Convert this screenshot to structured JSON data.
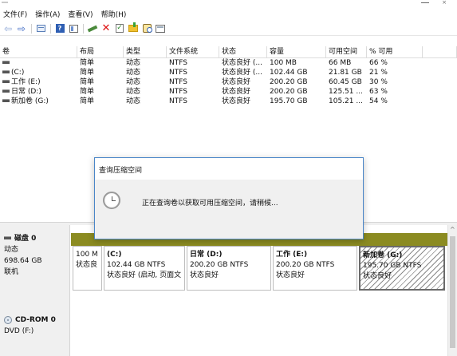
{
  "menu": [
    "文件(F)",
    "操作(A)",
    "查看(V)",
    "帮助(H)"
  ],
  "toolbar": [
    {
      "icon": "back-arrow-icon"
    },
    {
      "icon": "forward-arrow-icon"
    },
    {
      "icon": "disk-list-icon"
    },
    {
      "icon": "help-icon"
    },
    {
      "icon": "properties-icon"
    },
    {
      "icon": "connect-icon"
    },
    {
      "icon": "delete-icon"
    },
    {
      "icon": "check-icon"
    },
    {
      "icon": "new-folder-icon"
    },
    {
      "icon": "search-icon"
    },
    {
      "icon": "view-icon"
    }
  ],
  "table": {
    "headers": [
      "卷",
      "布局",
      "类型",
      "文件系统",
      "状态",
      "容量",
      "可用空间",
      "% 可用",
      ""
    ],
    "rows": [
      [
        "",
        "简单",
        "动态",
        "NTFS",
        "状态良好 (...",
        "100 MB",
        "66 MB",
        "66 %"
      ],
      [
        "(C:)",
        "简单",
        "动态",
        "NTFS",
        "状态良好 (...",
        "102.44 GB",
        "21.81 GB",
        "21 %"
      ],
      [
        "工作 (E:)",
        "简单",
        "动态",
        "NTFS",
        "状态良好",
        "200.20 GB",
        "60.45 GB",
        "30 %"
      ],
      [
        "日常 (D:)",
        "简单",
        "动态",
        "NTFS",
        "状态良好",
        "200.20 GB",
        "125.51 ...",
        "63 %"
      ],
      [
        "新加卷 (G:)",
        "简单",
        "动态",
        "NTFS",
        "状态良好",
        "195.70 GB",
        "105.21 ...",
        "54 %"
      ]
    ]
  },
  "dialog": {
    "title": "查询压缩空间",
    "message": "正在查询卷以获取可用压缩空间，请稍候...",
    "icon": "clock-icon"
  },
  "disk0": {
    "name": "磁盘 0",
    "type": "动态",
    "size": "698.64 GB",
    "status": "联机",
    "partitions": [
      {
        "title": "",
        "size": "100 M",
        "status": "状态良"
      },
      {
        "title": "(C:)",
        "size": "102.44 GB NTFS",
        "status": "状态良好 (启动, 页面文"
      },
      {
        "title": "日常  (D:)",
        "size": "200.20 GB NTFS",
        "status": "状态良好"
      },
      {
        "title": "工作  (E:)",
        "size": "200.20 GB NTFS",
        "status": "状态良好"
      },
      {
        "title": "新加卷  (G:)",
        "size": "195.70 GB NTFS",
        "status": "状态良好"
      }
    ]
  },
  "cdrom0": {
    "name": "CD-ROM 0",
    "drive": "DVD (F:)"
  },
  "colors": {
    "dynamic_volume_bar": "#8b8b21",
    "dialog_border": "#4a86c8",
    "selected_hatch": "#8a8a8a"
  }
}
